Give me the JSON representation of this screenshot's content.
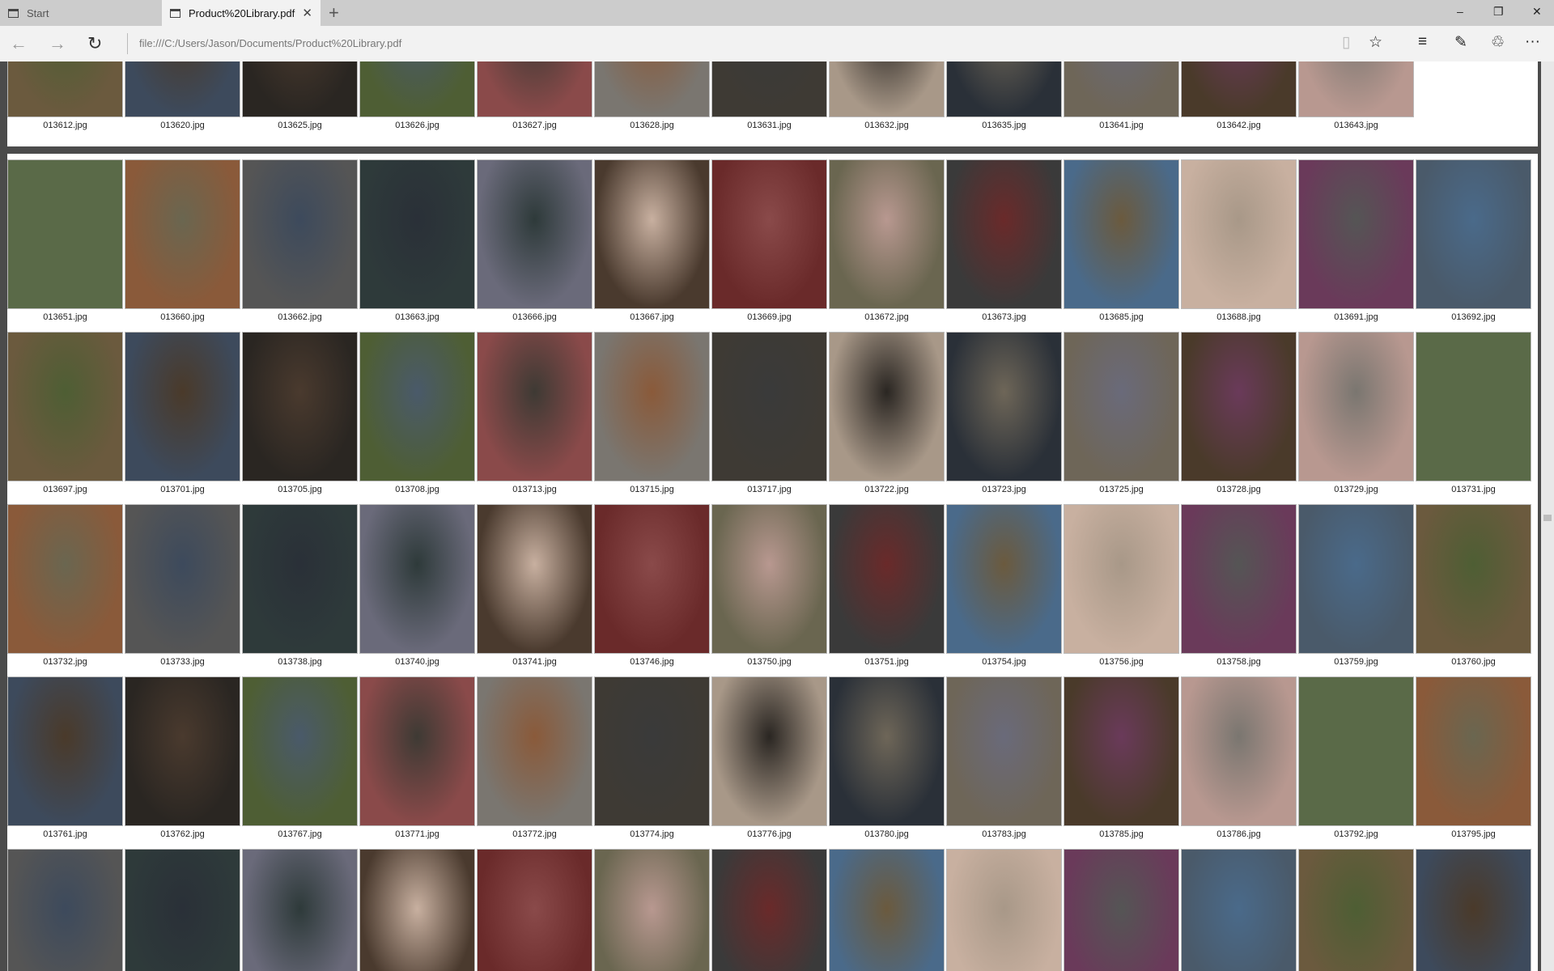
{
  "tabs": [
    {
      "label": "Start",
      "active": false
    },
    {
      "label": "Product%20Library.pdf",
      "active": true
    }
  ],
  "tab_close": "✕",
  "new_tab": "+",
  "window": {
    "minimize": "–",
    "restore": "❐",
    "close": "✕"
  },
  "nav": {
    "back": "←",
    "forward": "→",
    "refresh": "↻"
  },
  "address": "file:///C:/Users/Jason/Documents/Product%20Library.pdf",
  "toolbar": {
    "reading_view": "▯",
    "favorite": "☆",
    "hub": "≡",
    "web_note": "✎",
    "share": "♲",
    "more": "···"
  },
  "pages": [
    {
      "rows": [
        [
          "013612.jpg",
          "013620.jpg",
          "013625.jpg",
          "013626.jpg",
          "013627.jpg",
          "013628.jpg",
          "013631.jpg",
          "013632.jpg",
          "013635.jpg",
          "013641.jpg",
          "013642.jpg",
          "013643.jpg"
        ]
      ]
    },
    {
      "rows": [
        [
          "013651.jpg",
          "013660.jpg",
          "013662.jpg",
          "013663.jpg",
          "013666.jpg",
          "013667.jpg",
          "013669.jpg",
          "013672.jpg",
          "013673.jpg",
          "013685.jpg",
          "013688.jpg",
          "013691.jpg",
          "013692.jpg"
        ],
        [
          "013697.jpg",
          "013701.jpg",
          "013705.jpg",
          "013708.jpg",
          "013713.jpg",
          "013715.jpg",
          "013717.jpg",
          "013722.jpg",
          "013723.jpg",
          "013725.jpg",
          "013728.jpg",
          "013729.jpg",
          "013731.jpg"
        ],
        [
          "013732.jpg",
          "013733.jpg",
          "013738.jpg",
          "013740.jpg",
          "013741.jpg",
          "013746.jpg",
          "013750.jpg",
          "013751.jpg",
          "013754.jpg",
          "013756.jpg",
          "013758.jpg",
          "013759.jpg",
          "013760.jpg"
        ],
        [
          "013761.jpg",
          "013762.jpg",
          "013767.jpg",
          "013771.jpg",
          "013772.jpg",
          "013774.jpg",
          "013776.jpg",
          "013780.jpg",
          "013783.jpg",
          "013785.jpg",
          "013786.jpg",
          "013792.jpg",
          "013795.jpg"
        ],
        [
          "",
          "",
          "",
          "",
          "",
          "",
          "",
          "",
          "",
          "",
          "",
          "",
          ""
        ]
      ]
    }
  ],
  "thumb_colors": [
    "#6b5a3e",
    "#3d4a5c",
    "#2a2622",
    "#4e5e34",
    "#8a4a4a",
    "#7a7670",
    "#3e3a34",
    "#a89888",
    "#2a3038",
    "#6e6658",
    "#4a3a2a",
    "#b89890",
    "#5a6a48",
    "#8a5a3a",
    "#555",
    "#2e3a3a",
    "#6a6a7a",
    "#4a3a2e",
    "#6a2a2a",
    "#6a6650",
    "#3a3a3a",
    "#4a6a8a",
    "#c8b0a0",
    "#6a3a5a",
    "#4a5a6a"
  ]
}
